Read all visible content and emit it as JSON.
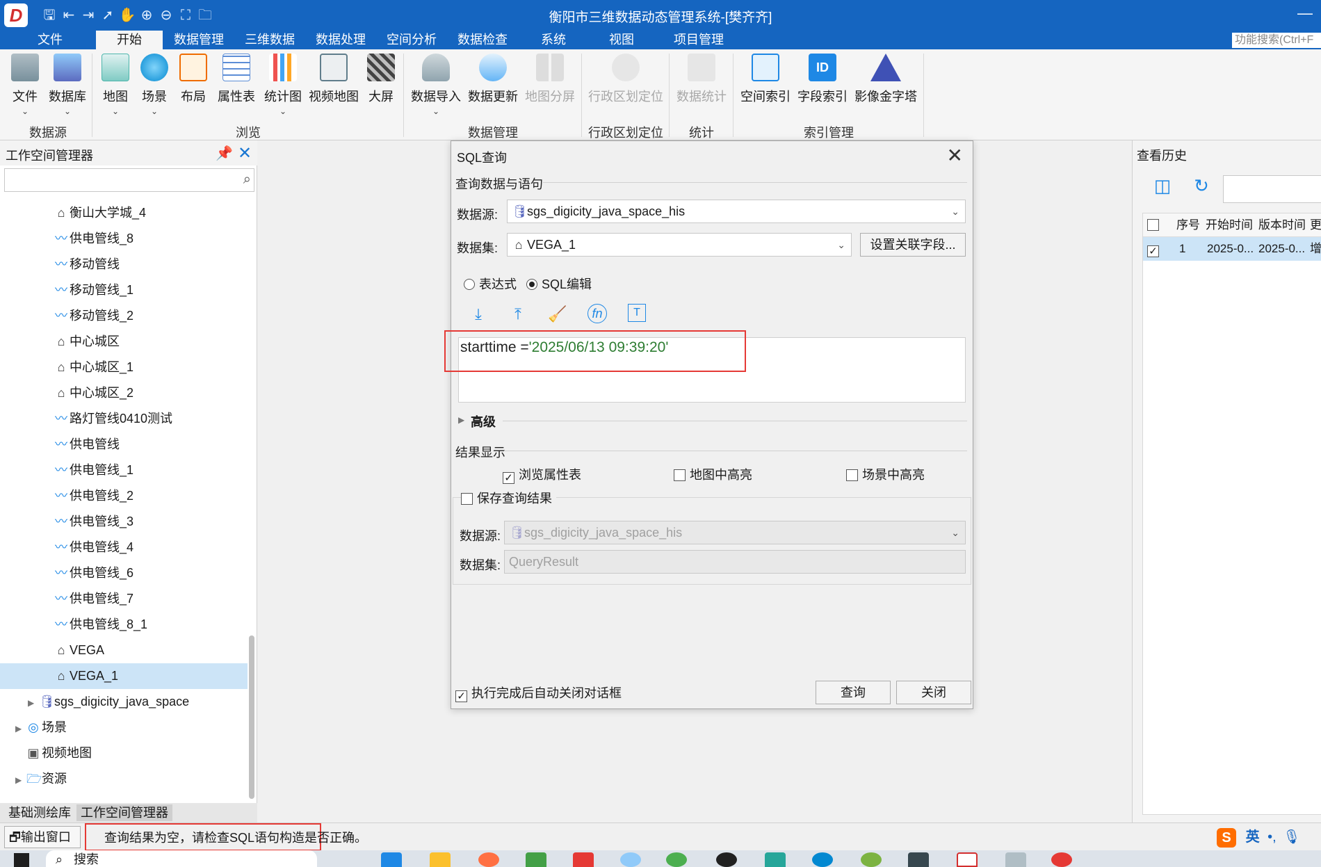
{
  "app": {
    "title": "衡阳市三维数据动态管理系统-[樊齐齐]",
    "logo_letter": "D",
    "quick_access": [
      "save-icon",
      "import-icon",
      "export-icon",
      "pointer-icon",
      "pan-icon",
      "zoom-in-icon",
      "zoom-out-icon",
      "full-extent-icon",
      "open-folder-icon"
    ],
    "minimize": "—"
  },
  "menu": {
    "tabs": [
      "文件",
      "开始",
      "数据管理",
      "三维数据",
      "数据处理",
      "空间分析",
      "数据检查",
      "系统",
      "视图",
      "项目管理"
    ],
    "active": "开始",
    "function_search": "功能搜索(Ctrl+F"
  },
  "ribbon": {
    "buttons": [
      {
        "label": "文件",
        "icon": "database-file-icon",
        "chevron": "⌄"
      },
      {
        "label": "数据库",
        "icon": "database-icon",
        "chevron": "⌄"
      },
      {
        "label": "地图",
        "icon": "map-icon",
        "chevron": "⌄"
      },
      {
        "label": "场景",
        "icon": "globe-icon",
        "chevron": "⌄"
      },
      {
        "label": "布局",
        "icon": "layout-icon"
      },
      {
        "label": "属性表",
        "icon": "table-icon"
      },
      {
        "label": "统计图",
        "icon": "bar-chart-icon",
        "chevron": "⌄"
      },
      {
        "label": "视频地图",
        "icon": "video-map-icon"
      },
      {
        "label": "大屏",
        "icon": "clapperboard-icon"
      },
      {
        "label": "数据导入",
        "icon": "data-import-icon",
        "chevron": "⌄"
      },
      {
        "label": "数据更新",
        "icon": "data-update-icon"
      },
      {
        "label": "地图分屏",
        "icon": "split-screen-icon",
        "disabled": true
      },
      {
        "label": "行政区划定位",
        "icon": "locate-icon",
        "disabled": true
      },
      {
        "label": "数据统计",
        "icon": "statistics-icon",
        "disabled": true
      },
      {
        "label": "空间索引",
        "icon": "spatial-index-icon"
      },
      {
        "label": "字段索引",
        "icon": "field-index-icon"
      },
      {
        "label": "影像金字塔",
        "icon": "pyramid-icon"
      }
    ],
    "groups": [
      "数据源",
      "浏览",
      "数据管理",
      "行政区划定位",
      "统计",
      "索引管理"
    ]
  },
  "workspace": {
    "title": "工作空间管理器",
    "pin_icon": "pin-icon",
    "close_icon": "close-icon",
    "search_placeholder": "",
    "items": [
      {
        "label": "衡山大学城_4",
        "type": "region"
      },
      {
        "label": "供电管线_8",
        "type": "line"
      },
      {
        "label": "移动管线",
        "type": "line"
      },
      {
        "label": "移动管线_1",
        "type": "line"
      },
      {
        "label": "移动管线_2",
        "type": "line"
      },
      {
        "label": "中心城区",
        "type": "region"
      },
      {
        "label": "中心城区_1",
        "type": "region"
      },
      {
        "label": "中心城区_2",
        "type": "region"
      },
      {
        "label": "路灯管线0410测试",
        "type": "line"
      },
      {
        "label": "供电管线",
        "type": "line"
      },
      {
        "label": "供电管线_1",
        "type": "line"
      },
      {
        "label": "供电管线_2",
        "type": "line"
      },
      {
        "label": "供电管线_3",
        "type": "line"
      },
      {
        "label": "供电管线_4",
        "type": "line"
      },
      {
        "label": "供电管线_6",
        "type": "line"
      },
      {
        "label": "供电管线_7",
        "type": "line"
      },
      {
        "label": "供电管线_8_1",
        "type": "line"
      },
      {
        "label": "VEGA",
        "type": "region"
      },
      {
        "label": "VEGA_1",
        "type": "region",
        "selected": true
      }
    ],
    "roots": [
      {
        "label": "sgs_digicity_java_space",
        "type": "db",
        "expander": "▶"
      },
      {
        "label": "场景",
        "type": "scene",
        "expander": "▶"
      },
      {
        "label": "视频地图",
        "type": "video",
        "expander": ""
      },
      {
        "label": "资源",
        "type": "folder",
        "expander": "▶"
      }
    ],
    "bottom_tabs": [
      "基础测绘库",
      "工作空间管理器"
    ],
    "active_tab": "工作空间管理器"
  },
  "sql_dialog": {
    "title": "SQL查询",
    "section_query": "查询数据与语句",
    "datasource_label": "数据源:",
    "datasource_value": "sgs_digicity_java_space_his",
    "dataset_label": "数据集:",
    "dataset_value": "VEGA_1",
    "set_join_button": "设置关联字段...",
    "mode_expression": "表达式",
    "mode_sql": "SQL编辑",
    "mode_selected": "SQL编辑",
    "toolbar": [
      "import-sql-icon",
      "export-sql-icon",
      "clear-icon",
      "function-icon",
      "field-icon"
    ],
    "sql_field": "starttime",
    "sql_operator": " =",
    "sql_value": "'2025/06/13 09:39:20'",
    "advanced_label": "高级",
    "result_section": "结果显示",
    "browse_table_label": "浏览属性表",
    "browse_table_checked": true,
    "map_highlight_label": "地图中高亮",
    "map_highlight_checked": false,
    "scene_highlight_label": "场景中高亮",
    "scene_highlight_checked": false,
    "save_result_label": "保存查询结果",
    "save_result_checked": false,
    "save_datasource_label": "数据源:",
    "save_datasource_value": "sgs_digicity_java_space_his",
    "save_dataset_label": "数据集:",
    "save_dataset_value": "QueryResult",
    "auto_close_label": "执行完成后自动关闭对话框",
    "auto_close_checked": true,
    "query_button": "查询",
    "close_button": "关闭"
  },
  "history": {
    "title": "查看历史",
    "tools": [
      "compare-icon",
      "history-refresh-icon"
    ],
    "columns": [
      "序号",
      "开始时间",
      "版本时间",
      "更"
    ],
    "rows": [
      {
        "checked": true,
        "index": "1",
        "start": "2025-0...",
        "version": "2025-0...",
        "extra": "增"
      }
    ]
  },
  "status": {
    "output_button": "输出窗口",
    "message": "查询结果为空，请检查SQL语句构造是否正确。",
    "ime_logo": "S",
    "ime_lang": "英",
    "ime_punct": "•,",
    "ime_mic": "mic-icon"
  },
  "taskbar": {
    "search_text": "搜索",
    "start_icon": "windows-start-icon",
    "search_icon": "search-icon"
  },
  "colors": {
    "titlebar": "#1565c0",
    "accent": "#1e88e5",
    "selection": "#cce4f7",
    "highlight_box": "#e53935",
    "sql_string": "#2e7d32"
  }
}
